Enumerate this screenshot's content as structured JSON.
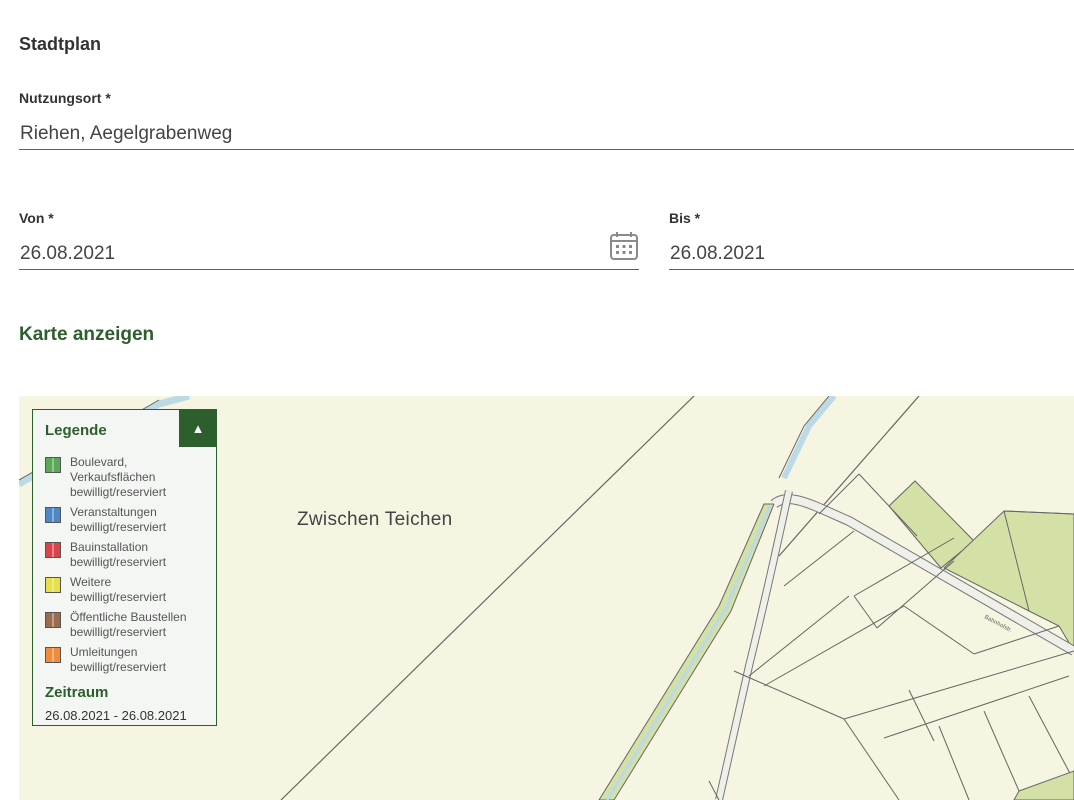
{
  "form": {
    "section_title": "Stadtplan",
    "location_label": "Nutzungsort *",
    "location_value": "Riehen, Aegelgrabenweg",
    "from_label": "Von *",
    "from_value": "26.08.2021",
    "to_label": "Bis *",
    "to_value": "26.08.2021",
    "calendar_icon": "calendar-icon",
    "map_toggle_label": "Karte anzeigen"
  },
  "map": {
    "place_label": "Zwischen Teichen",
    "street_label_small": "Bahnhofstr.",
    "colors": {
      "background": "#f5f5e1",
      "green_area": "#d3e1a6",
      "water": "#bcd9e6",
      "lines": "#666666"
    }
  },
  "legend": {
    "title": "Legende",
    "toggle_icon": "chevron-up-icon",
    "items": [
      {
        "line1": "Boulevard,",
        "line2": "Verkaufsflächen",
        "line3": "bewilligt/reserviert",
        "color": "#5ba85b"
      },
      {
        "line1": "Veranstaltungen",
        "line2": "bewilligt/reserviert",
        "color": "#4f86c6"
      },
      {
        "line1": "Bauinstallation",
        "line2": "bewilligt/reserviert",
        "color": "#d9444b"
      },
      {
        "line1": "Weitere",
        "line2": "bewilligt/reserviert",
        "color": "#e6e04a"
      },
      {
        "line1": "Öffentliche Baustellen",
        "line2": "bewilligt/reserviert",
        "color": "#9b6b4e"
      },
      {
        "line1": "Umleitungen",
        "line2": "bewilligt/reserviert",
        "color": "#f08a3c"
      }
    ],
    "period_title": "Zeitraum",
    "period_value": "26.08.2021 - 26.08.2021"
  }
}
